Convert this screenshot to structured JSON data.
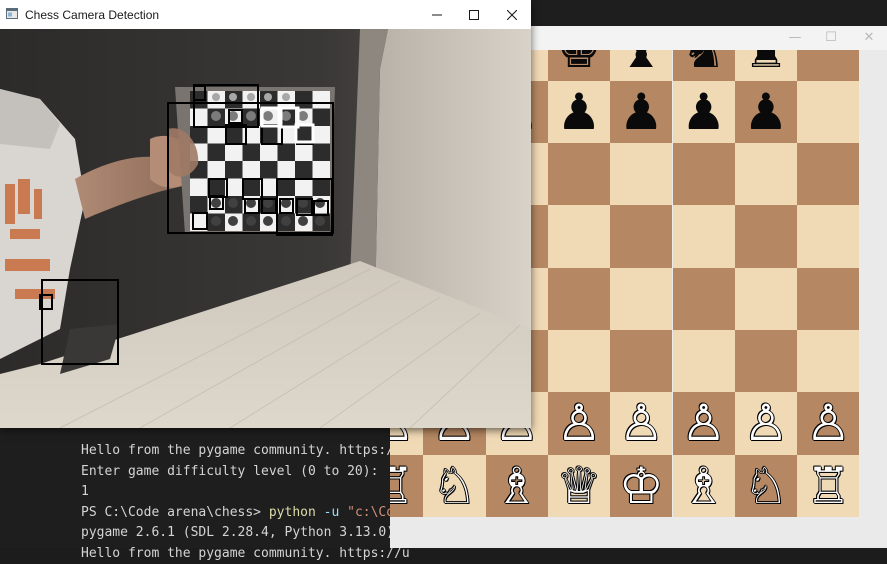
{
  "terminal": {
    "lines": [
      {
        "pre": "Hello from the pygame community. https://u",
        "cmd": "",
        "arg": "",
        "str": ""
      },
      {
        "pre": "Enter game difficulty level (0 to 20):",
        "cmd": "",
        "arg": "",
        "str": ""
      },
      {
        "pre": "1",
        "cmd": "",
        "arg": "",
        "str": ""
      },
      {
        "pre": "PS C:\\Code arena\\chess> ",
        "cmd": "python",
        "arg": " -u ",
        "str": "\"c:\\Code"
      },
      {
        "pre": "pygame 2.6.1 (SDL 2.28.4, Python 3.13.0)",
        "cmd": "",
        "arg": "",
        "str": ""
      },
      {
        "pre": "Hello from the pygame community. https://u",
        "cmd": "",
        "arg": "",
        "str": ""
      }
    ]
  },
  "camera_window": {
    "title": "Chess Camera Detection",
    "minimize_label": "—",
    "maximize_label": "☐",
    "close_label": "✕"
  },
  "board_window": {
    "minimize_label": "—",
    "maximize_label": "☐",
    "close_label": "✕",
    "colors": {
      "light": "#f0d9b5",
      "dark": "#b58863"
    },
    "ranks": [
      [
        "",
        "♝",
        "♛",
        "♚",
        "♝",
        "♞",
        "♜",
        ""
      ],
      [
        "",
        "♟",
        "♟",
        "♟",
        "♟",
        "♟",
        "♟",
        ""
      ],
      [
        "",
        "",
        "",
        "",
        "",
        "",
        "",
        ""
      ],
      [
        "",
        "",
        "",
        "",
        "",
        "",
        "",
        ""
      ],
      [
        "",
        "",
        "",
        "",
        "",
        "",
        "",
        ""
      ],
      [
        "",
        "",
        "",
        "",
        "",
        "",
        "",
        ""
      ],
      [
        "♙",
        "♙",
        "♙",
        "♙",
        "♙",
        "♙",
        "♙",
        "♙"
      ],
      [
        "♖",
        "♘",
        "♗",
        "♕",
        "♔",
        "♗",
        "♘",
        "♖"
      ]
    ]
  }
}
